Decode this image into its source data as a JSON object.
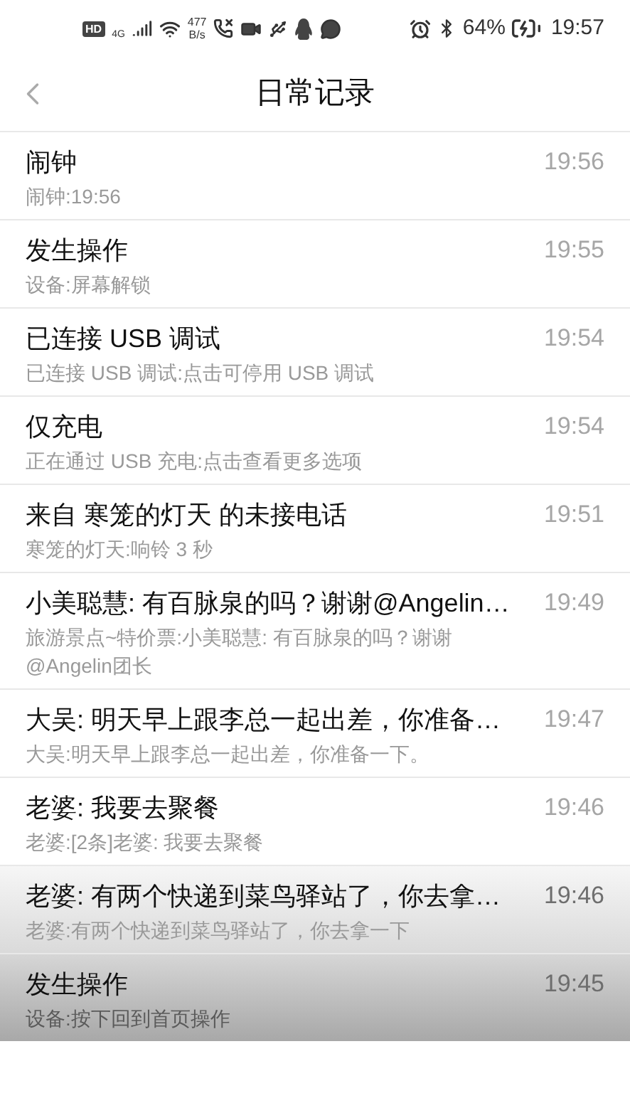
{
  "status_bar": {
    "hd_badge": "HD",
    "network": "4G",
    "speed_value": "477",
    "speed_unit": "B/s",
    "battery": "64%",
    "time": "19:57"
  },
  "header": {
    "title": "日常记录"
  },
  "records": [
    {
      "title": "闹钟",
      "detail": "闹钟:19:56",
      "time": "19:56"
    },
    {
      "title": "发生操作",
      "detail": "设备:屏幕解锁",
      "time": "19:55"
    },
    {
      "title": "已连接 USB 调试",
      "detail": "已连接 USB 调试:点击可停用 USB 调试",
      "time": "19:54"
    },
    {
      "title": "仅充电",
      "detail": "正在通过 USB 充电:点击查看更多选项",
      "time": "19:54"
    },
    {
      "title": "来自 寒笼的灯天 的未接电话",
      "detail": "寒笼的灯天:响铃 3 秒",
      "time": "19:51"
    },
    {
      "title": "小美聪慧: 有百脉泉的吗？谢谢@Angelin…",
      "detail": "旅游景点~特价票:小美聪慧: 有百脉泉的吗？谢谢@Angelin团长",
      "time": "19:49"
    },
    {
      "title": "大吴: 明天早上跟李总一起出差，你准备…",
      "detail": "大吴:明天早上跟李总一起出差，你准备一下。",
      "time": "19:47"
    },
    {
      "title": "老婆: 我要去聚餐",
      "detail": "老婆:[2条]老婆: 我要去聚餐",
      "time": "19:46"
    },
    {
      "title": "老婆: 有两个快递到菜鸟驿站了，你去拿…",
      "detail": "老婆:有两个快递到菜鸟驿站了，你去拿一下",
      "time": "19:46"
    },
    {
      "title": "发生操作",
      "detail": "设备:按下回到首页操作",
      "time": "19:45"
    }
  ]
}
